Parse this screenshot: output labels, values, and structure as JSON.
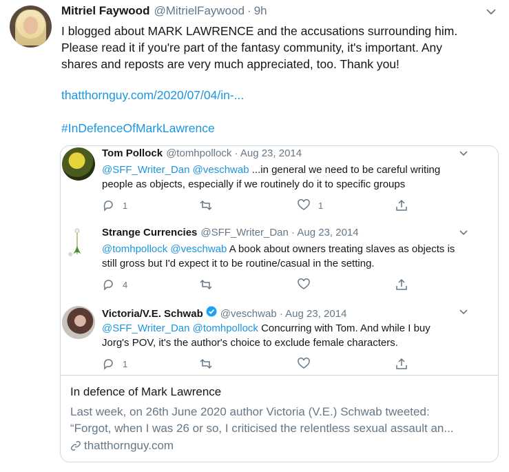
{
  "tweet": {
    "name": "Mitriel Faywood",
    "handle": "@MitrielFaywood",
    "separator": "·",
    "time": "9h",
    "text_line1": "I blogged about MARK LAWRENCE and the accusations surrounding him.",
    "text_line2": "Please read it if you're part of the fantasy community, it's important. Any",
    "text_line3": "shares and reposts are very much appreciated, too. Thank you!",
    "url": "thatthornguy.com/2020/07/04/in-...",
    "hashtag": "#InDefenceOfMarkLawrence"
  },
  "quoted_tweets": [
    {
      "name": "Tom Pollock",
      "meta": "@tomhpollock · Aug 23, 2014",
      "mentions": "@SFF_Writer_Dan @veschwab",
      "text_a": " ...in general we need to be careful writing",
      "text_b": "people as objects, especially if we routinely do it to specific groups",
      "replies": "1",
      "likes": "1"
    },
    {
      "name": "Strange Currencies",
      "meta": "@SFF_Writer_Dan · Aug 23, 2014",
      "mentions": "@tomhpollock @veschwab",
      "text_a": " A book about owners treating slaves as objects is",
      "text_b": "still gross but I'd expect it to be routine/casual in the setting.",
      "replies": "4",
      "likes": ""
    },
    {
      "name": "Victoria/V.E. Schwab",
      "meta": "@veschwab · Aug 23, 2014",
      "mentions": "@SFF_Writer_Dan @tomhpollock",
      "text_a": " Concurring with Tom. And while I buy",
      "text_b": "Jorg's POV, it's the author's choice to exclude female characters.",
      "replies": "1",
      "likes": ""
    }
  ],
  "card": {
    "title": "In defence of Mark Lawrence",
    "desc_line1": "Last week, on 26th June 2020 author Victoria (V.E.) Schwab tweeted:",
    "desc_line2": "“Forgot, when I was 26 or so, I criticised the relentless sexual assault an...",
    "domain": "thatthornguy.com"
  },
  "colors": {
    "link": "#1b95e0",
    "muted": "#657786",
    "text": "#14171a",
    "border": "#ccd6dd",
    "verified": "#1da1f2"
  },
  "icons": [
    "chevron-down-icon",
    "reply-icon",
    "retweet-icon",
    "like-icon",
    "share-icon",
    "verified-icon",
    "link-icon"
  ]
}
